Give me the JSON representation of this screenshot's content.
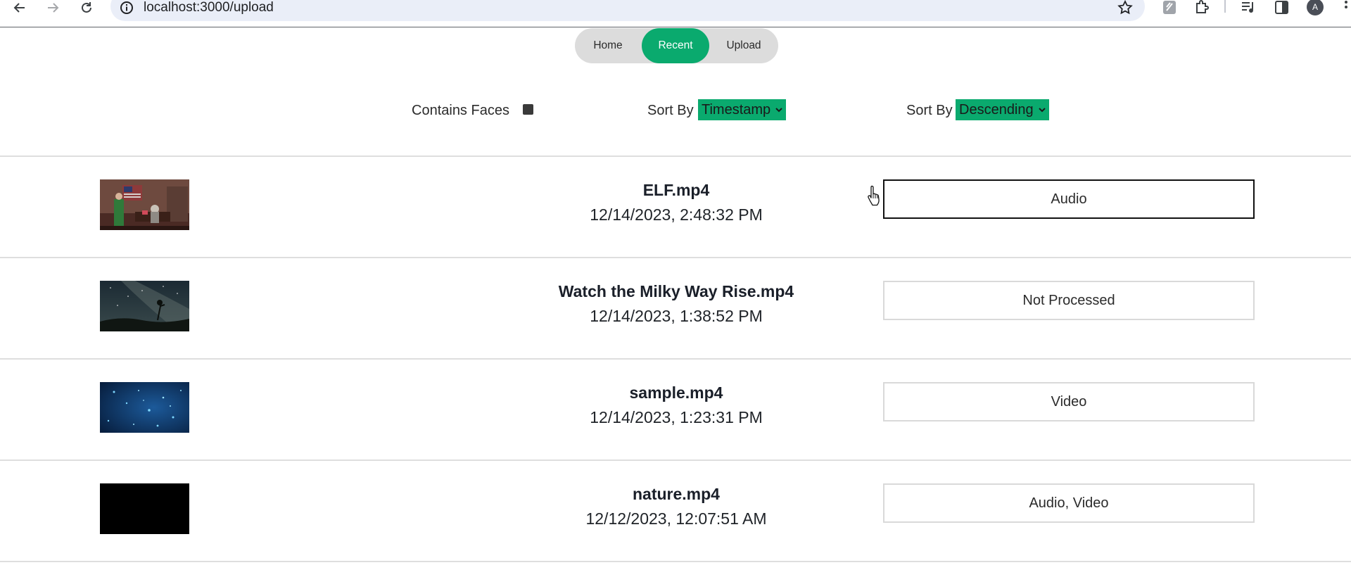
{
  "browser": {
    "url": "localhost:3000/upload",
    "avatar_initial": "A"
  },
  "nav": {
    "tabs": [
      {
        "label": "Home",
        "active": false
      },
      {
        "label": "Recent",
        "active": true
      },
      {
        "label": "Upload",
        "active": false
      }
    ]
  },
  "filters": {
    "faces_label": "Contains Faces",
    "faces_checked": true,
    "sort_field_label": "Sort By",
    "sort_field_value": "Timestamp",
    "sort_order_label": "Sort By",
    "sort_order_value": "Descending"
  },
  "colors": {
    "accent": "#0aaa6e",
    "tab_bg": "#dcdcdc"
  },
  "videos": [
    {
      "name": "ELF.mp4",
      "timestamp": "12/14/2023, 2:48:32 PM",
      "status": "Audio",
      "thumb": "office-scene"
    },
    {
      "name": "Watch the Milky Way Rise.mp4",
      "timestamp": "12/14/2023, 1:38:52 PM",
      "status": "Not Processed",
      "thumb": "night-sky"
    },
    {
      "name": "sample.mp4",
      "timestamp": "12/14/2023, 1:23:31 PM",
      "status": "Video",
      "thumb": "blue-particles"
    },
    {
      "name": "nature.mp4",
      "timestamp": "12/12/2023, 12:07:51 AM",
      "status": "Audio, Video",
      "thumb": "black-frame"
    }
  ]
}
